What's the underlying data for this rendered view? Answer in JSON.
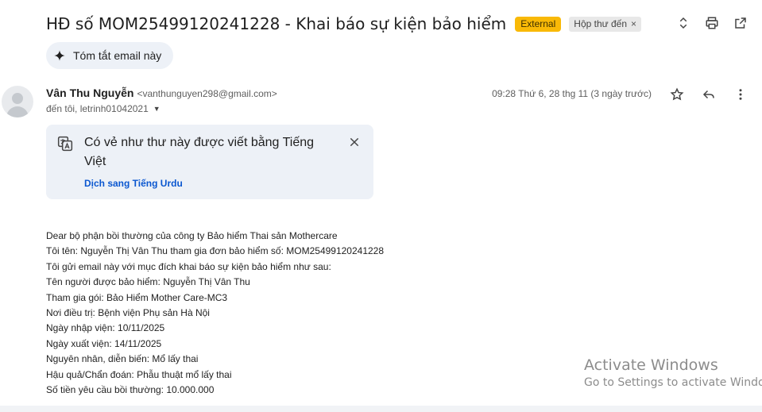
{
  "email": {
    "subject": "HĐ số MOM25499120241228 - Khai báo sự kiện bảo hiểm",
    "labels": {
      "external": "External",
      "inbox": "Hộp thư đến",
      "inbox_remove": "×"
    },
    "summary_button": "Tóm tắt email này",
    "sender": {
      "name": "Vân Thu Nguyễn",
      "email": "<vanthunguyen298@gmail.com>"
    },
    "recipients": "đến tôi, letrinh01042021",
    "timestamp": "09:28 Thứ 6, 28 thg 11 (3 ngày trước)",
    "icons": {
      "top": [
        "expand-collapse-icon",
        "print-icon",
        "open-in-new-window-icon"
      ],
      "message": [
        "star-icon",
        "reply-icon",
        "more-vert-icon"
      ],
      "summary": "sparkle-icon",
      "translate": "translate-icon"
    }
  },
  "translate_card": {
    "message": "Có vẻ như thư này được viết bằng Tiếng Việt",
    "link": "Dịch sang Tiếng Urdu"
  },
  "body": {
    "lines": [
      "Dear bộ phận bồi thường của công ty Bảo hiểm Thai sản Mothercare",
      "Tôi tên: Nguyễn Thị Vân Thu tham gia đơn bảo hiểm số: MOM25499120241228",
      "Tôi gửi email này với mục đích khai báo sự kiện bảo hiểm như sau:",
      "Tên người được bảo hiểm: Nguyễn Thị Vân Thu",
      "Tham gia gói: Bảo Hiểm Mother Care-MC3",
      "Nơi điều trị: Bệnh viện Phụ sản Hà Nội",
      "Ngày nhập viện: 10/11/2025",
      "Ngày xuất viện: 14/11/2025",
      "Nguyên nhân, diễn biến: Mổ lấy thai",
      "Hậu quả/Chẩn đoán: Phẫu thuật mổ lấy thai",
      "Số tiền yêu cầu bồi thường: 10.000.000"
    ]
  },
  "watermark": {
    "title": "Activate Windows",
    "subtitle": "Go to Settings to activate Windows."
  },
  "colors": {
    "external_badge": "#f9b907",
    "link": "#0b57d0",
    "card_bg": "#edf1f7"
  }
}
